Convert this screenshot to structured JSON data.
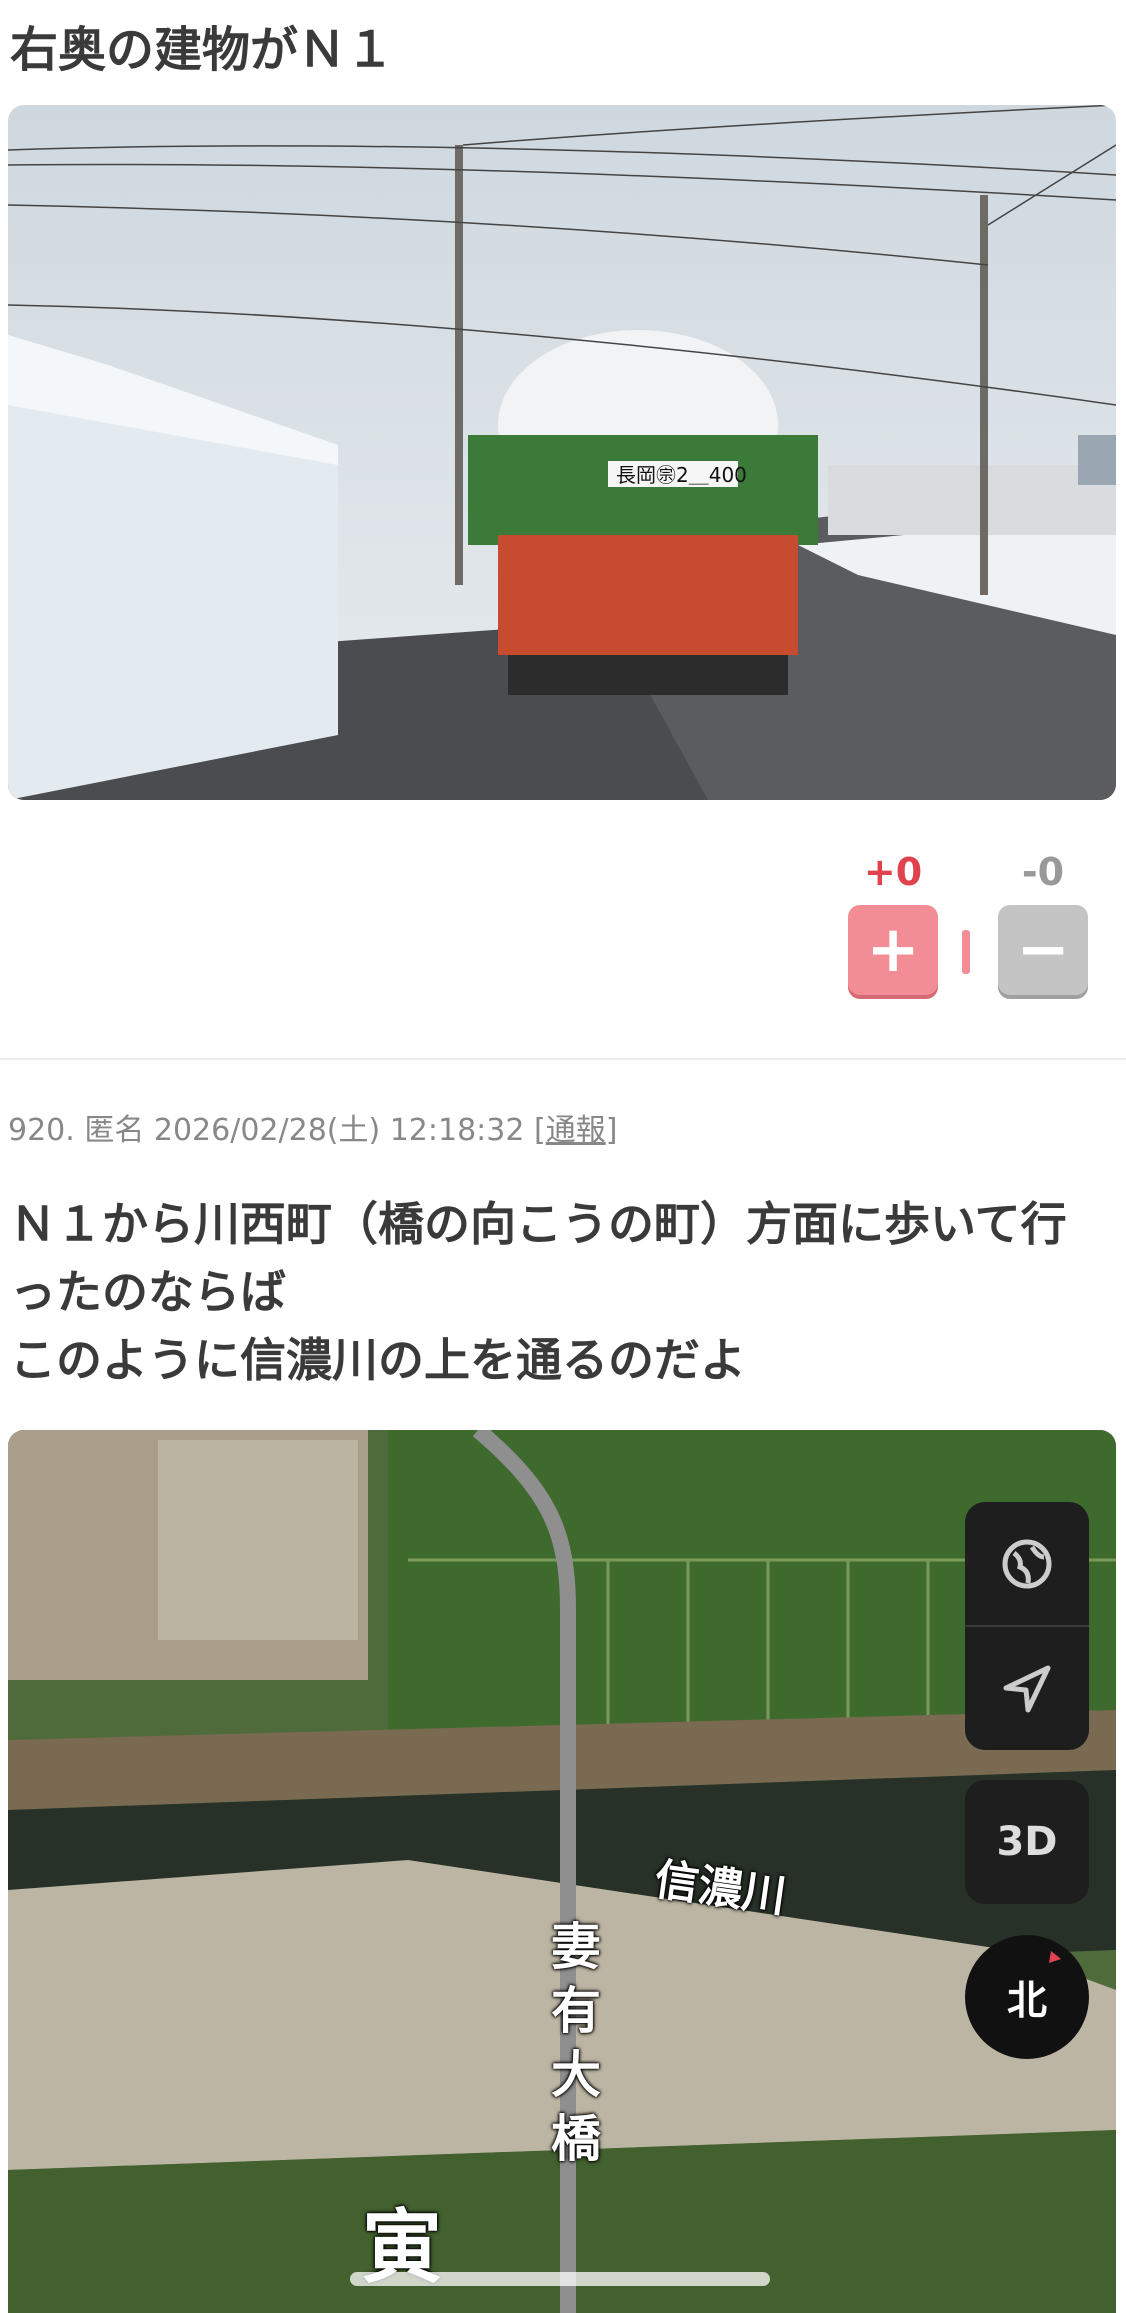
{
  "post_top": {
    "title": "右奥の建物がＮ１",
    "plate_text": "長岡㊪2＿400",
    "votes": {
      "plus_count": "+0",
      "minus_count": "-0",
      "plus_symbol": "+",
      "minus_symbol": "−"
    }
  },
  "post": {
    "meta_prefix": "920. 匿名 2026/02/28(土) 12:18:32 [",
    "report_label": "通報",
    "meta_suffix": "]",
    "lines": [
      "Ｎ１から川西町（橋の向こうの町）方面に歩いて行",
      "ったのならば",
      "このように信濃川の上を通るのだよ"
    ]
  },
  "map": {
    "river_label": "信濃川",
    "bridge_label": "妻有大橋",
    "area_label": "寅",
    "three_d_label": "3D",
    "compass_label": "北",
    "icons": [
      "globe-icon",
      "location-arrow-icon"
    ]
  },
  "colors": {
    "accent_plus": "#e0434e",
    "plus_button": "#f28d96",
    "minus_button": "#c4c4c4"
  }
}
